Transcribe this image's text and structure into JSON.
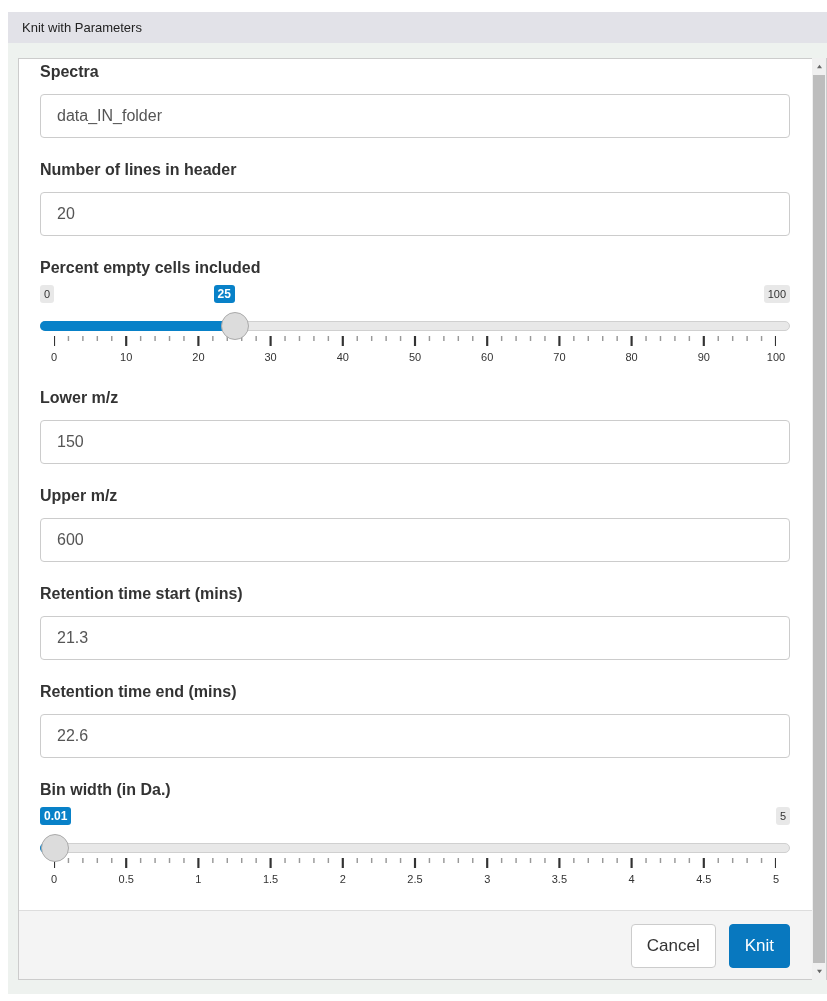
{
  "window": {
    "title": "Knit with Parameters"
  },
  "params": [
    {
      "kind": "text",
      "label": "Spectra",
      "value": "data_IN_folder"
    },
    {
      "kind": "text",
      "label": "Number of lines in header",
      "value": "20"
    },
    {
      "kind": "slider",
      "label": "Percent empty cells included",
      "min_label": "0",
      "max_label": "100",
      "value_label": "25",
      "level": 0.25,
      "ticks": [
        "0",
        "10",
        "20",
        "30",
        "40",
        "50",
        "60",
        "70",
        "80",
        "90",
        "100"
      ]
    },
    {
      "kind": "text",
      "label": "Lower m/z",
      "value": "150"
    },
    {
      "kind": "text",
      "label": "Upper m/z",
      "value": "600"
    },
    {
      "kind": "text",
      "label": "Retention time start (mins)",
      "value": "21.3"
    },
    {
      "kind": "text",
      "label": "Retention time end (mins)",
      "value": "22.6"
    },
    {
      "kind": "slider",
      "label": "Bin width (in Da.)",
      "max_label": "5",
      "value_label": "0.01",
      "level": 0.002,
      "ticks": [
        "0",
        "0.5",
        "1",
        "1.5",
        "2",
        "2.5",
        "3",
        "3.5",
        "4",
        "4.5",
        "5"
      ]
    }
  ],
  "buttons": [
    {
      "label": "Cancel",
      "primary": false
    },
    {
      "label": "Knit",
      "primary": true
    }
  ]
}
